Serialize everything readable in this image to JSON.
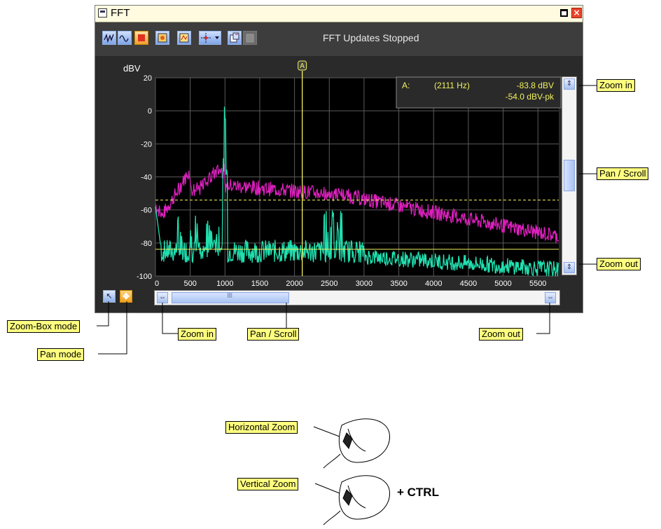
{
  "window": {
    "title": "FFT",
    "close_glyph": "×",
    "status": "FFT Updates Stopped"
  },
  "toolbar": {
    "buttons": [
      {
        "name": "freq-spectrum-icon"
      },
      {
        "name": "waveform-icon"
      },
      {
        "name": "stop-icon"
      },
      {
        "name": "settings-icon"
      },
      {
        "name": "zoom-fit-icon"
      },
      {
        "name": "cursor-options-icon"
      },
      {
        "name": "copy-icon"
      },
      {
        "name": "paste-icon"
      }
    ]
  },
  "plot": {
    "ylabel": "dBV",
    "y_ticks": [
      "20",
      "0",
      "-20",
      "-40",
      "-60",
      "-80",
      "-100"
    ],
    "x_ticks": [
      "0",
      "500",
      "1000",
      "1500",
      "2000",
      "2500",
      "3000",
      "3500",
      "4000",
      "4500",
      "5000",
      "5500"
    ],
    "xlim": [
      0,
      5800
    ],
    "ylim": [
      -100,
      20
    ],
    "cursor": {
      "label": "A",
      "freq_hz": 2111
    },
    "readout": {
      "label": "A:",
      "freq": "(2111 Hz)",
      "value1": "-83.8  dBV",
      "value2": "-54.0  dBV-pk"
    },
    "marker_levels": {
      "solid": -83.8,
      "dashed": -54.0
    },
    "colors": {
      "magenta": "#e020c0",
      "cyan": "#20e0b0",
      "cursor": "#f0f060",
      "grid": "#5a5a5a",
      "bg": "#000000"
    }
  },
  "bottom": {
    "zoombox_glyph": "↖",
    "pan_glyph": "✥"
  },
  "callouts": {
    "zoom_in_v": "Zoom in",
    "pan_scroll_v": "Pan / Scroll",
    "zoom_out_v": "Zoom out",
    "zoom_box_mode": "Zoom-Box mode",
    "pan_mode": "Pan mode",
    "zoom_in_h": "Zoom in",
    "pan_scroll_h": "Pan / Scroll",
    "zoom_out_h": "Zoom out",
    "horizontal_zoom": "Horizontal Zoom",
    "vertical_zoom": "Vertical Zoom",
    "plus_ctrl": "+ CTRL"
  }
}
